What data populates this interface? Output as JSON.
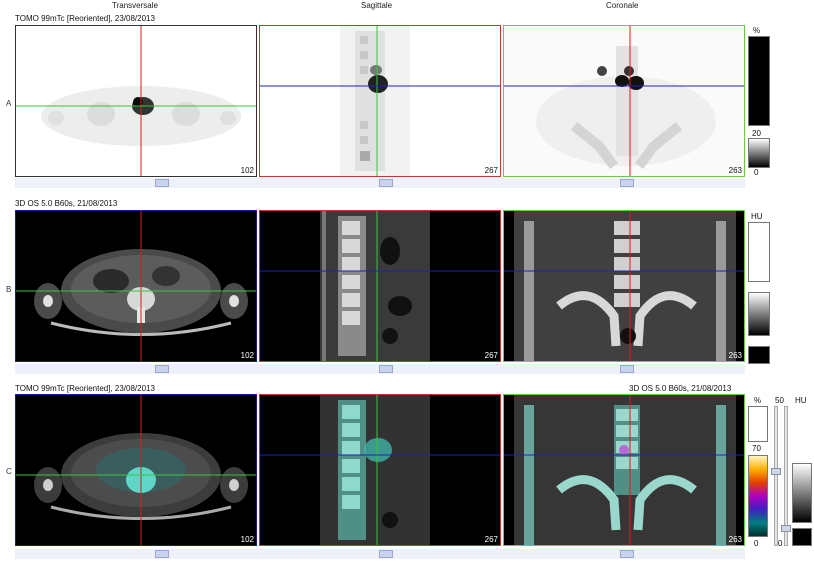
{
  "headers": {
    "transversale": "Transversale",
    "sagittale": "Sagittale",
    "coronale": "Coronale"
  },
  "rows": {
    "a": {
      "letter": "A",
      "title": "TOMO 99mTc [Reoriented], 23/08/2013",
      "slices": {
        "transversale": "102",
        "sagittale": "267",
        "coronale": "263"
      }
    },
    "b": {
      "letter": "B",
      "title": "3D  OS  5.0  B60s, 21/08/2013",
      "slices": {
        "transversale": "102",
        "sagittale": "267",
        "coronale": "263"
      }
    },
    "c": {
      "letter": "C",
      "title": "TOMO 99mTc [Reoriented], 23/08/2013",
      "title_right": "3D  OS  5.0  B60s, 21/08/2013",
      "slices": {
        "transversale": "102",
        "sagittale": "267",
        "coronale": "263"
      }
    }
  },
  "colorbars": {
    "nm": {
      "unit": "%",
      "mid": "20",
      "low": "0"
    },
    "ct": {
      "unit": "HU"
    },
    "fusion": {
      "unit": "%",
      "top": "50",
      "mid": "70",
      "low": "0",
      "ct_unit": "HU",
      "ct_low": "0"
    }
  },
  "colors": {
    "transversale_border": "#1a1a8c",
    "sagittale_border": "#cc3333",
    "coronale_border": "#66cc44",
    "crosshair_red": "#d02020",
    "crosshair_green": "#3cc43c",
    "crosshair_blue": "#2020c0"
  }
}
